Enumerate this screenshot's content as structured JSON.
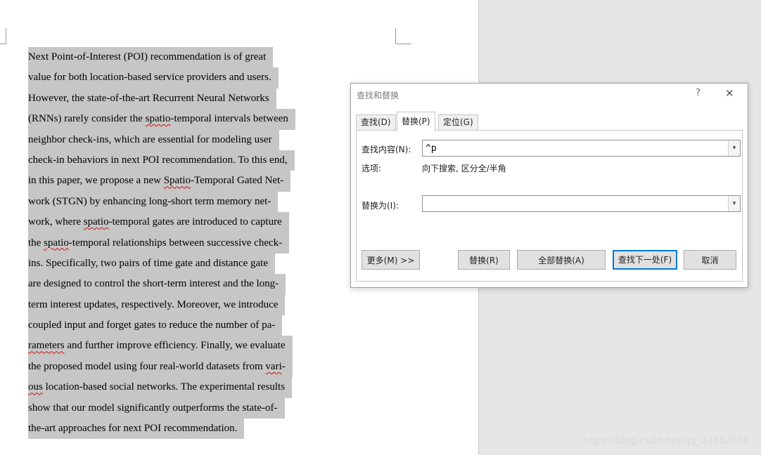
{
  "document": {
    "lines": [
      {
        "segments": [
          {
            "t": "Next Point-of-Interest (POI) recommendation is of great",
            "s": false
          }
        ]
      },
      {
        "segments": [
          {
            "t": "value for both location-based service providers and users.",
            "s": false
          }
        ]
      },
      {
        "segments": [
          {
            "t": "However, the state-of-the-art Recurrent Neural Networks",
            "s": false
          }
        ]
      },
      {
        "segments": [
          {
            "t": "(RNNs) rarely consider the ",
            "s": false
          },
          {
            "t": "spatio",
            "s": true
          },
          {
            "t": "-temporal intervals between",
            "s": false
          }
        ]
      },
      {
        "segments": [
          {
            "t": "neighbor check-ins, which are essential for modeling user",
            "s": false
          }
        ]
      },
      {
        "segments": [
          {
            "t": "check-in behaviors in next POI recommendation. To this end,",
            "s": false
          }
        ]
      },
      {
        "segments": [
          {
            "t": "in this paper, we propose a new ",
            "s": false
          },
          {
            "t": "Spatio",
            "s": true
          },
          {
            "t": "-Temporal Gated Net-",
            "s": false
          }
        ]
      },
      {
        "segments": [
          {
            "t": "work (STGN) by enhancing long-short term memory net-",
            "s": false
          }
        ]
      },
      {
        "segments": [
          {
            "t": "work, where ",
            "s": false
          },
          {
            "t": "spatio",
            "s": true
          },
          {
            "t": "-temporal gates are introduced to capture",
            "s": false
          }
        ]
      },
      {
        "segments": [
          {
            "t": "the ",
            "s": false
          },
          {
            "t": "spatio",
            "s": true
          },
          {
            "t": "-temporal relationships between successive check-",
            "s": false
          }
        ]
      },
      {
        "segments": [
          {
            "t": "ins. Specifically, two pairs of time gate and distance gate",
            "s": false
          }
        ]
      },
      {
        "segments": [
          {
            "t": "are designed to control the short-term interest and the long-",
            "s": false
          }
        ]
      },
      {
        "segments": [
          {
            "t": "term interest updates, respectively. Moreover, we introduce",
            "s": false
          }
        ]
      },
      {
        "segments": [
          {
            "t": "coupled input and forget gates to reduce the number of pa-",
            "s": false
          }
        ]
      },
      {
        "segments": [
          {
            "t": "rameters",
            "s": true
          },
          {
            "t": " and further improve efficiency. Finally, we evaluate",
            "s": false
          }
        ]
      },
      {
        "segments": [
          {
            "t": "the proposed model using four real-world datasets from ",
            "s": false
          },
          {
            "t": "vari",
            "s": true
          },
          {
            "t": "-",
            "s": false
          }
        ]
      },
      {
        "segments": [
          {
            "t": "ous",
            "s": true
          },
          {
            "t": " location-based social networks. The experimental results",
            "s": false
          }
        ]
      },
      {
        "segments": [
          {
            "t": "show that our model significantly outperforms the state-of-",
            "s": false
          }
        ]
      },
      {
        "segments": [
          {
            "t": "the-art approaches for next POI recommendation.",
            "s": false
          }
        ]
      }
    ]
  },
  "watermark": "https://blog.csdn.net/qq_34862636",
  "dialog": {
    "title": "查找和替换",
    "help": "?",
    "close": "✕",
    "tabs": {
      "find": "查找(D)",
      "replace": "替换(P)",
      "goto": "定位(G)"
    },
    "find_label": "查找内容(N):",
    "find_value": "^p",
    "options_label": "选项:",
    "options_value": "向下搜索, 区分全/半角",
    "replace_label": "替换为(I):",
    "replace_value": "",
    "dropdown_arrow": "▾",
    "buttons": {
      "more": "更多(M) >>",
      "replace": "替换(R)",
      "replace_all": "全部替换(A)",
      "find_next": "查找下一处(F)",
      "cancel": "取消"
    }
  }
}
